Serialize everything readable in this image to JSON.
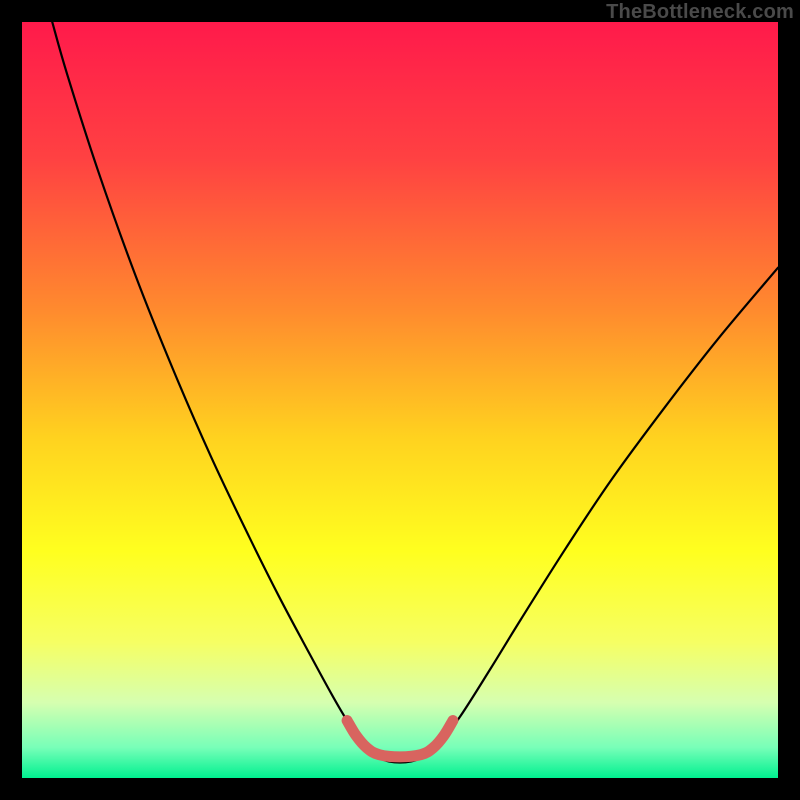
{
  "watermark": "TheBottleneck.com",
  "chart_data": {
    "type": "line",
    "title": "",
    "xlabel": "",
    "ylabel": "",
    "xlim": [
      0,
      100
    ],
    "ylim": [
      0,
      100
    ],
    "background_gradient": {
      "stops": [
        {
          "offset": 0.0,
          "color": "#ff1a4b"
        },
        {
          "offset": 0.18,
          "color": "#ff4142"
        },
        {
          "offset": 0.38,
          "color": "#ff8a2e"
        },
        {
          "offset": 0.55,
          "color": "#ffd21f"
        },
        {
          "offset": 0.7,
          "color": "#ffff1f"
        },
        {
          "offset": 0.82,
          "color": "#f6ff63"
        },
        {
          "offset": 0.9,
          "color": "#d6ffb0"
        },
        {
          "offset": 0.96,
          "color": "#77ffb8"
        },
        {
          "offset": 1.0,
          "color": "#00f090"
        }
      ]
    },
    "series": [
      {
        "name": "bottleneck-curve",
        "color": "#000000",
        "width": 2.2,
        "points": [
          {
            "x": 4.0,
            "y": 100.0
          },
          {
            "x": 6.0,
            "y": 93.0
          },
          {
            "x": 10.0,
            "y": 80.5
          },
          {
            "x": 15.0,
            "y": 66.5
          },
          {
            "x": 20.0,
            "y": 54.0
          },
          {
            "x": 25.0,
            "y": 42.5
          },
          {
            "x": 30.0,
            "y": 32.0
          },
          {
            "x": 34.0,
            "y": 24.0
          },
          {
            "x": 38.0,
            "y": 16.5
          },
          {
            "x": 41.0,
            "y": 11.0
          },
          {
            "x": 43.0,
            "y": 7.6
          },
          {
            "x": 45.0,
            "y": 4.8
          },
          {
            "x": 46.5,
            "y": 3.2
          },
          {
            "x": 48.5,
            "y": 2.2
          },
          {
            "x": 51.5,
            "y": 2.2
          },
          {
            "x": 53.5,
            "y": 3.2
          },
          {
            "x": 55.5,
            "y": 5.0
          },
          {
            "x": 58.0,
            "y": 8.2
          },
          {
            "x": 62.0,
            "y": 14.5
          },
          {
            "x": 66.0,
            "y": 21.0
          },
          {
            "x": 72.0,
            "y": 30.5
          },
          {
            "x": 78.0,
            "y": 39.5
          },
          {
            "x": 85.0,
            "y": 49.0
          },
          {
            "x": 92.0,
            "y": 58.0
          },
          {
            "x": 100.0,
            "y": 67.5
          }
        ]
      },
      {
        "name": "optimal-band",
        "color": "#d8645f",
        "width": 11,
        "linecap": "round",
        "points": [
          {
            "x": 43.0,
            "y": 7.6
          },
          {
            "x": 44.2,
            "y": 5.6
          },
          {
            "x": 45.6,
            "y": 4.0
          },
          {
            "x": 47.2,
            "y": 3.1
          },
          {
            "x": 50.0,
            "y": 2.8
          },
          {
            "x": 52.8,
            "y": 3.1
          },
          {
            "x": 54.4,
            "y": 4.0
          },
          {
            "x": 55.8,
            "y": 5.6
          },
          {
            "x": 57.0,
            "y": 7.6
          }
        ]
      }
    ]
  }
}
